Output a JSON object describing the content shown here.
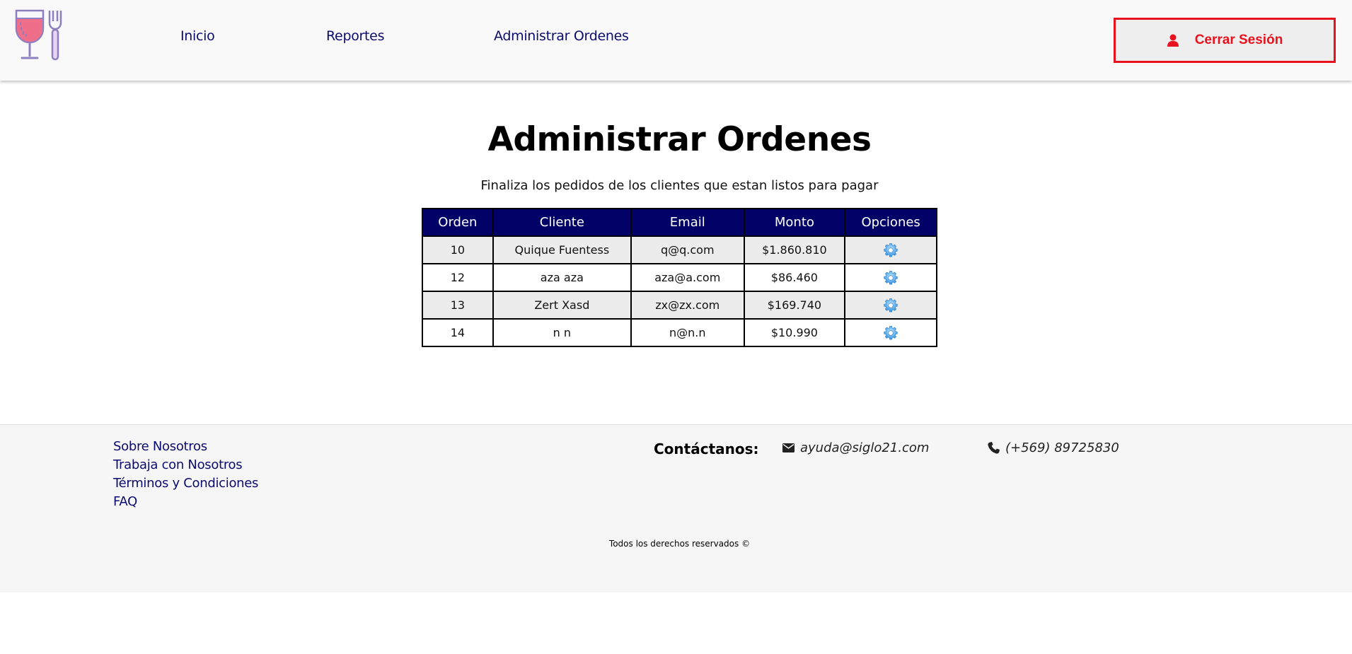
{
  "header": {
    "logo_icon": "wine-glass-and-fork-logo",
    "nav": [
      {
        "label": "Inicio"
      },
      {
        "label": "Reportes"
      },
      {
        "label": "Administrar Ordenes"
      }
    ],
    "logout": {
      "label": "Cerrar Sesión",
      "icon": "user-icon",
      "color": "#e8121e"
    }
  },
  "main": {
    "title": "Administrar Ordenes",
    "subtitle": "Finaliza los pedidos de los clientes que estan listos para pagar",
    "table": {
      "headers": [
        "Orden",
        "Cliente",
        "Email",
        "Monto",
        "Opciones"
      ],
      "header_color": "#000066",
      "rows": [
        {
          "orden": "10",
          "cliente": "Quique Fuentess",
          "email": "q@q.com",
          "monto": "$1.860.810",
          "opciones_icon": "gear-icon"
        },
        {
          "orden": "12",
          "cliente": "aza aza",
          "email": "aza@a.com",
          "monto": "$86.460",
          "opciones_icon": "gear-icon"
        },
        {
          "orden": "13",
          "cliente": "Zert Xasd",
          "email": "zx@zx.com",
          "monto": "$169.740",
          "opciones_icon": "gear-icon"
        },
        {
          "orden": "14",
          "cliente": "n n",
          "email": "n@n.n",
          "monto": "$10.990",
          "opciones_icon": "gear-icon"
        }
      ]
    }
  },
  "footer": {
    "links": [
      {
        "label": "Sobre Nosotros"
      },
      {
        "label": "Trabaja con Nosotros"
      },
      {
        "label": "Términos y Condiciones"
      },
      {
        "label": "FAQ"
      }
    ],
    "contact_title": "Contáctanos:",
    "email": {
      "icon": "envelope-icon",
      "value": "ayuda@siglo21.com"
    },
    "phone": {
      "icon": "phone-icon",
      "value": "(+569) 89725830"
    },
    "copyright": "Todos los derechos reservados ©"
  }
}
